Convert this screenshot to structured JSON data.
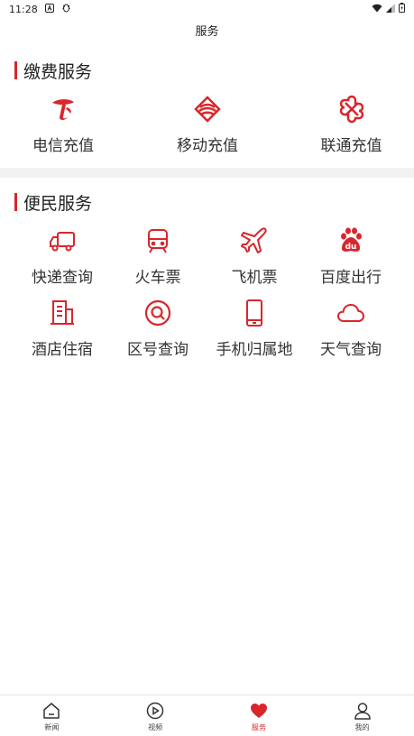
{
  "status_bar": {
    "time": "11:28"
  },
  "header": {
    "title": "服务"
  },
  "payment": {
    "title": "缴费服务",
    "items": [
      {
        "label": "电信充值",
        "icon": "china-telecom-icon"
      },
      {
        "label": "移动充值",
        "icon": "china-mobile-icon"
      },
      {
        "label": "联通充值",
        "icon": "china-unicom-icon"
      }
    ]
  },
  "convenience": {
    "title": "便民服务",
    "items": [
      {
        "label": "快递查询",
        "icon": "truck-icon"
      },
      {
        "label": "火车票",
        "icon": "train-icon"
      },
      {
        "label": "飞机票",
        "icon": "airplane-icon"
      },
      {
        "label": "百度出行",
        "icon": "baidu-paw-icon"
      },
      {
        "label": "酒店住宿",
        "icon": "hotel-building-icon"
      },
      {
        "label": "区号查询",
        "icon": "search-icon"
      },
      {
        "label": "手机归属地",
        "icon": "phone-icon"
      },
      {
        "label": "天气查询",
        "icon": "cloud-icon"
      }
    ]
  },
  "tabs": [
    {
      "label": "新闻",
      "icon": "home-icon",
      "active": false
    },
    {
      "label": "视频",
      "icon": "play-icon",
      "active": false
    },
    {
      "label": "服务",
      "icon": "heart-icon",
      "active": true
    },
    {
      "label": "我的",
      "icon": "user-icon",
      "active": false
    }
  ],
  "colors": {
    "accent": "#d9262c",
    "divider": "#f2f2f2"
  }
}
